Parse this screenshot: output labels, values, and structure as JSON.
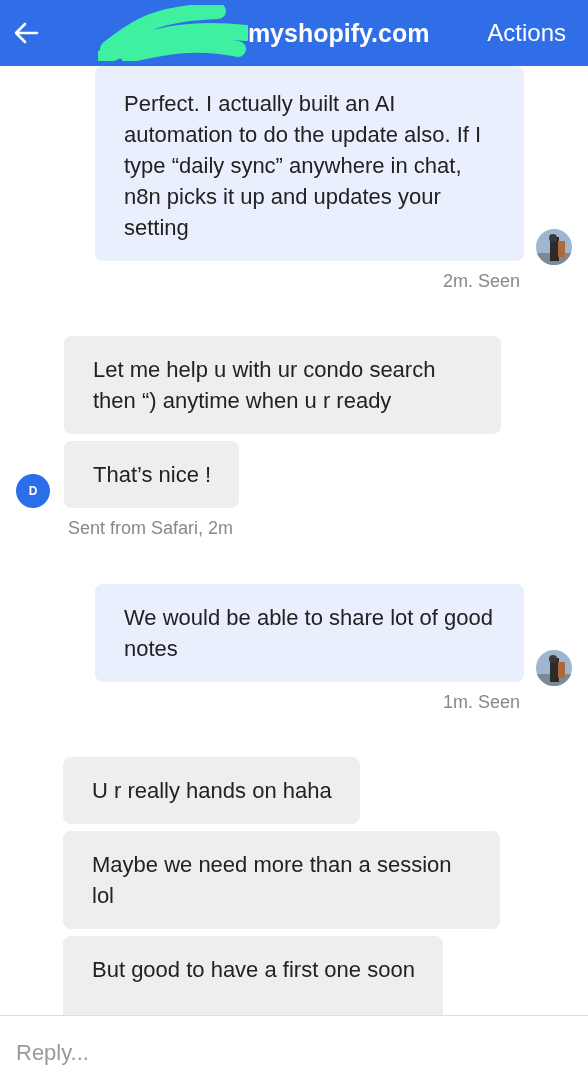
{
  "header": {
    "title": "myshopify.com",
    "action": "Actions"
  },
  "groups": [
    {
      "kind": "outgoing",
      "bubbles": [
        "Perfect. I actually built an AI automation to do the update also. If I type “daily sync” anywhere in chat, n8n picks it up and updates your setting"
      ],
      "meta": "2m. Seen"
    },
    {
      "kind": "incoming",
      "avatar": "D",
      "bubbles": [
        "Let me help u with ur condo search then “) anytime when u r ready",
        "That’s nice !"
      ],
      "meta": "Sent from Safari, 2m"
    },
    {
      "kind": "outgoing",
      "bubbles": [
        "We would be able to share lot of good notes"
      ],
      "meta": "1m. Seen"
    },
    {
      "kind": "incoming",
      "bubbles": [
        "U r really hands on haha",
        "Maybe we need more than a session lol",
        "But good to have a first one soon"
      ]
    }
  ],
  "reply": {
    "placeholder": "Reply..."
  }
}
